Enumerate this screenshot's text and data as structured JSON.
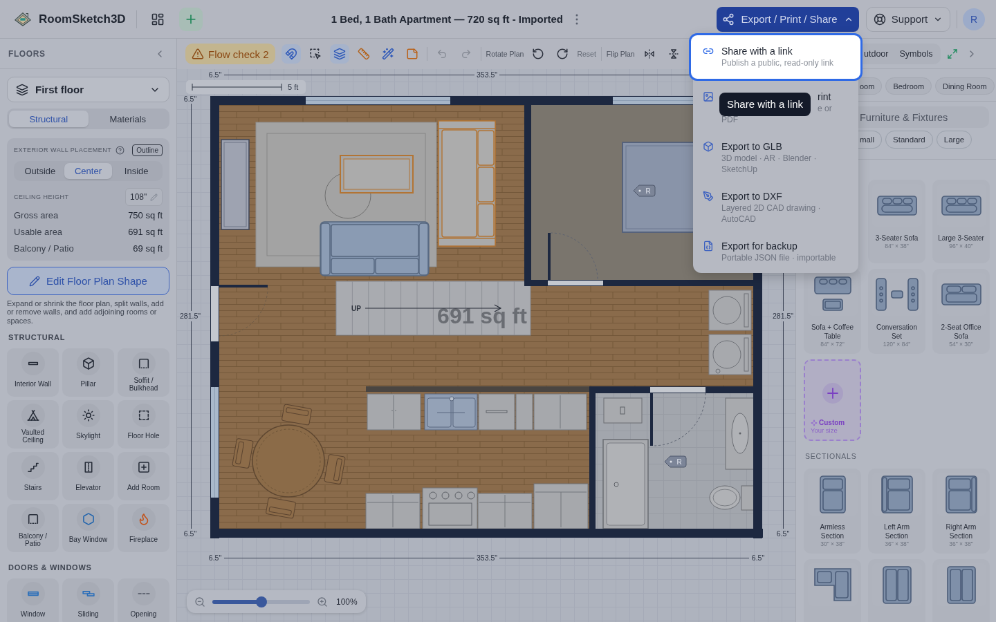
{
  "header": {
    "app_name": "RoomSketch3D",
    "title": "1 Bed, 1 Bath Apartment — 720 sq ft - Imported",
    "export_button": {
      "label": "Export / Print / Share",
      "expanded": true
    },
    "support_button": {
      "label": "Support"
    },
    "avatar": "R"
  },
  "sidebar": {
    "heading": "FLOORS",
    "floor": "First floor",
    "tabs": [
      {
        "label": "Structural",
        "selected": true
      },
      {
        "label": "Materials",
        "selected": false
      }
    ],
    "wall_placement": {
      "label": "EXTERIOR WALL PLACEMENT",
      "badge": "Outline",
      "options": [
        {
          "label": "Outside",
          "selected": false
        },
        {
          "label": "Center",
          "selected": true
        },
        {
          "label": "Inside",
          "selected": false
        }
      ]
    },
    "ceiling_height": {
      "label": "CEILING HEIGHT",
      "value": "108\""
    },
    "areas": [
      {
        "label": "Gross area",
        "value": "750 sq ft"
      },
      {
        "label": "Usable area",
        "value": "691 sq ft"
      },
      {
        "label": "Balcony / Patio",
        "value": "69 sq ft"
      }
    ],
    "edit_button": "Edit Floor Plan Shape",
    "help_text": "Expand or shrink the floor plan, split walls, add or remove walls, and add adjoining rooms or spaces.",
    "sections": [
      {
        "title": "STRUCTURAL",
        "items": [
          {
            "kind": "wall",
            "label": "Interior Wall"
          },
          {
            "kind": "pillar",
            "label": "Pillar"
          },
          {
            "kind": "soffit",
            "label": "Soffit / Bulkhead"
          },
          {
            "kind": "vaulted",
            "label": "Vaulted Ceiling"
          },
          {
            "kind": "skylight",
            "label": "Skylight"
          },
          {
            "kind": "hole",
            "label": "Floor Hole"
          },
          {
            "kind": "stairs",
            "label": "Stairs"
          },
          {
            "kind": "elevator",
            "label": "Elevator"
          },
          {
            "kind": "room",
            "label": "Add Room"
          },
          {
            "kind": "balcony",
            "label": "Balcony / Patio"
          },
          {
            "kind": "bay",
            "label": "Bay Window"
          },
          {
            "kind": "fireplace",
            "label": "Fireplace"
          }
        ]
      },
      {
        "title": "DOORS & WINDOWS",
        "items": [
          {
            "kind": "window",
            "label": "Window"
          },
          {
            "kind": "sliding",
            "label": "Sliding"
          },
          {
            "kind": "opening",
            "label": "Opening"
          }
        ]
      }
    ]
  },
  "toolbar": {
    "flow_check": "Flow check 2",
    "tools": [
      {
        "kind": "magnet",
        "active": true
      },
      {
        "kind": "select",
        "active": false
      },
      {
        "kind": "layers",
        "active": true
      },
      {
        "kind": "ruler",
        "active": false
      },
      {
        "kind": "wand",
        "active": false
      },
      {
        "kind": "note",
        "active": false
      }
    ],
    "history": [
      {
        "kind": "undo",
        "disabled": true
      },
      {
        "kind": "redo",
        "disabled": true
      }
    ],
    "rotate": {
      "label": "Rotate Plan",
      "reset": "Reset",
      "reset_disabled": true
    },
    "flip": {
      "label": "Flip Plan"
    }
  },
  "canvas": {
    "scale_label": "5 ft",
    "area_label": "691 sq ft",
    "stairs_label": "UP",
    "room_markers": [
      "R",
      "R"
    ],
    "dimensions": {
      "top": [
        "6.5\"",
        "353.5\""
      ],
      "left": [
        "6.5\"",
        "281.5\"",
        "6.5\""
      ],
      "right": [
        "281.5\"",
        "6.5\""
      ],
      "bottom": [
        "6.5\"",
        "353.5\"",
        "6.5\""
      ]
    },
    "zoom": {
      "level": 0.5,
      "label": "100%"
    }
  },
  "export_menu": {
    "items": [
      {
        "kind": "link",
        "title": "Share with a link",
        "description": "Publish a public, read-only link",
        "highlighted": true
      },
      {
        "kind": "image",
        "title": "rint",
        "description_fragments": [
          "e or",
          "PDF"
        ],
        "highlighted": false
      },
      {
        "kind": "cube",
        "title": "Export to GLB",
        "description": "3D model · AR · Blender · SketchUp",
        "highlighted": false
      },
      {
        "kind": "pen",
        "title": "Export to DXF",
        "description": "Layered 2D CAD drawing · AutoCAD",
        "highlighted": false
      },
      {
        "kind": "file",
        "title": "Export for backup",
        "description": "Portable JSON file · importable",
        "highlighted": false
      }
    ]
  },
  "tooltip": "Share with a link",
  "library": {
    "tabs": [
      "utdoor",
      "Symbols"
    ],
    "rooms": [
      "oom",
      "Bedroom",
      "Dining Room"
    ],
    "search_placeholder": "Furniture & Fixtures",
    "sizes": [
      "mall",
      "Standard",
      "Large"
    ],
    "groups": [
      {
        "items": [
          {
            "kind": "sofa3",
            "name": "3-Seater Sofa",
            "size": "84\" × 38\""
          },
          {
            "kind": "sofa3",
            "name": "Large 3-Seater",
            "size": "96\" × 40\""
          },
          {
            "kind": "sofa_table",
            "name": "Sofa + Coffee Table",
            "size": "84\" × 72\""
          },
          {
            "kind": "conversation",
            "name": "Conversation Set",
            "size": "120\" × 84\""
          },
          {
            "kind": "sofa2",
            "name": "2-Seat Office Sofa",
            "size": "54\" × 30\""
          },
          {
            "kind": "custom",
            "name": "Custom",
            "size": "Your size"
          }
        ]
      },
      {
        "title": "SECTIONALS",
        "items": [
          {
            "kind": "armless",
            "name": "Armless Section",
            "size": "30\" × 38\""
          },
          {
            "kind": "left_arm",
            "name": "Left Arm Section",
            "size": "36\" × 38\""
          },
          {
            "kind": "right_arm",
            "name": "Right Arm Section",
            "size": "36\" × 38\""
          },
          {
            "kind": "corner"
          },
          {
            "kind": "chaise_left"
          },
          {
            "kind": "chaise_right"
          }
        ]
      }
    ]
  }
}
